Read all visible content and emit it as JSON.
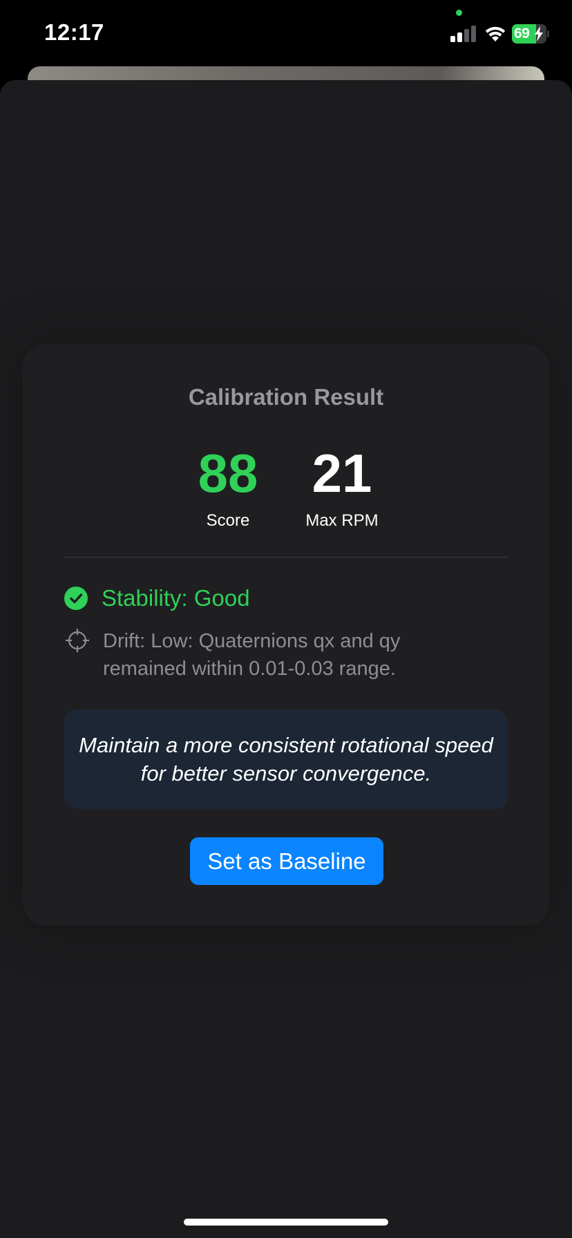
{
  "status_bar": {
    "time": "12:17",
    "battery_level": "69",
    "battery_fraction": 0.69,
    "signal_bars": 2,
    "signal_total": 4,
    "icons": [
      "signal-icon",
      "wifi-icon",
      "battery-icon",
      "charging-bolt-icon"
    ]
  },
  "colors": {
    "accent_green": "#30d158",
    "button_blue": "#0a84ff",
    "sheet_background": "#1c1c1e",
    "tip_background": "#1c2634"
  },
  "result": {
    "title": "Calibration Result",
    "score_value": "88",
    "score_label": "Score",
    "rpm_value": "21",
    "rpm_label": "Max RPM",
    "stability_text": "Stability: Good",
    "drift_text": "Drift: Low: Quaternions qx and qy remained within 0.01-0.03 range.",
    "tip_text": "Maintain a more consistent rotational speed for better sensor convergence.",
    "button_label": "Set as Baseline"
  }
}
